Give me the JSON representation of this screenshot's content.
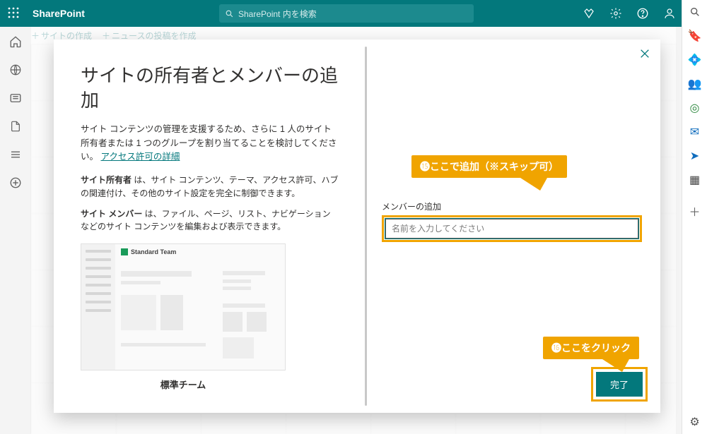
{
  "header": {
    "app_name": "SharePoint",
    "search_placeholder": "SharePoint 内を検索"
  },
  "cmd_bar": {
    "create_site": "サイトの作成",
    "create_news": "ニュースの投稿を作成"
  },
  "modal": {
    "title": "サイトの所有者とメンバーの追加",
    "body_pre": "サイト コンテンツの管理を支援するため、さらに 1 人のサイト所有者または 1 つのグループを割り当てることを検討してください。",
    "body_link": "アクセス許可の詳細",
    "owners_label": "サイト所有者",
    "owners_text": " は、サイト コンテンツ、テーマ、アクセス許可、ハブの関連付け、その他のサイト設定を完全に制御できます。",
    "members_label": "サイト メンバー",
    "members_text": " は、ファイル、ページ、リスト、ナビゲーションなどのサイト コンテンツを編集および表示できます。",
    "template_name_inner": "Standard Team",
    "template_label": "標準チーム",
    "add_members_label": "メンバーの追加",
    "add_members_placeholder": "名前を入力してください",
    "finish": "完了"
  },
  "callouts": {
    "c15_num": "⓯",
    "c15_text": "ここで追加（※スキップ可）",
    "c16_num": "⓰",
    "c16_text": "ここをクリック"
  }
}
